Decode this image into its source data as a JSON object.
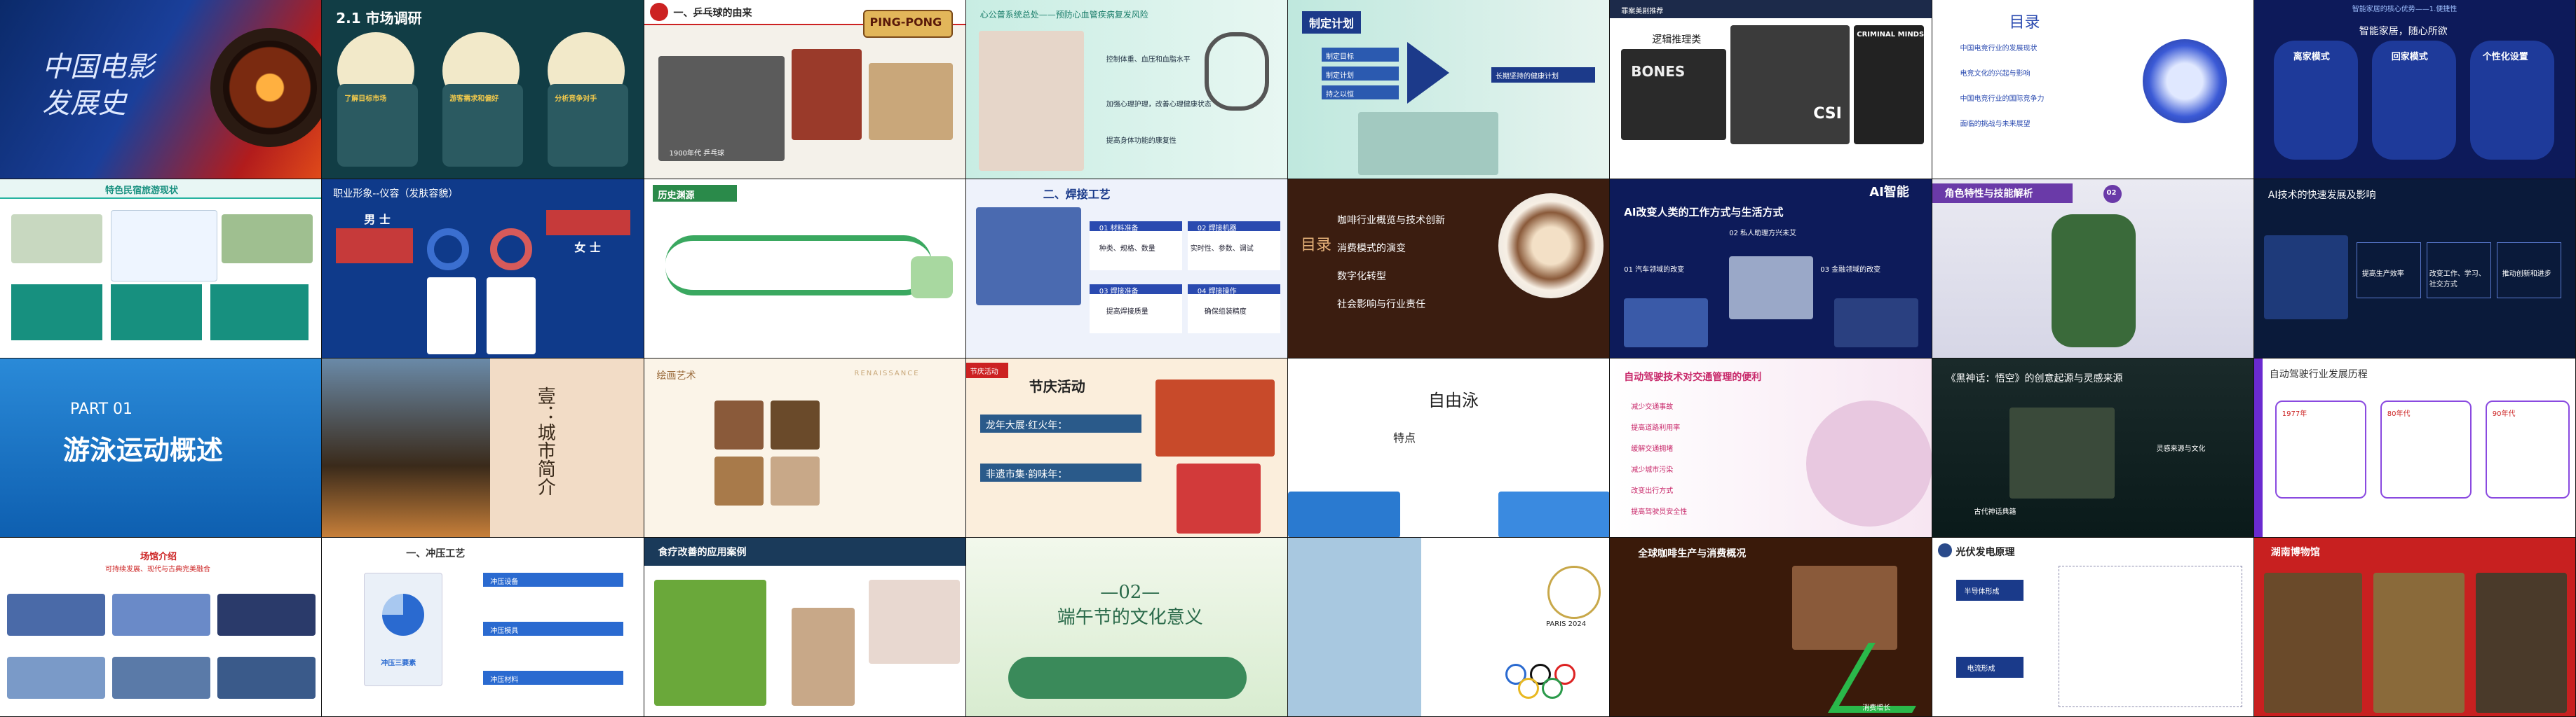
{
  "tiles": [
    {
      "title": "中国电影\n发展史"
    },
    {
      "title": "2.1  市场调研",
      "cards": [
        "了解目标市场",
        "游客需求和偏好",
        "分析竞争对手"
      ]
    },
    {
      "title": "一、乒乓球的由来",
      "sign": "PING-PONG",
      "caption": "1900年代  乒乓球"
    },
    {
      "title": "心公普系统总处——预防心血管疾病复发风险",
      "items": [
        "控制体重、血压和血脂水平",
        "加强心理护理，改善心理健康状态",
        "提高身体功能的康复性"
      ]
    },
    {
      "title": "制定计划",
      "items": [
        "制定目标",
        "制定计划",
        "持之以恒"
      ],
      "arrow": "长期坚持的健康计划"
    },
    {
      "title": "罪案美剧推荐",
      "subtitle": "逻辑推理类",
      "shows": [
        "BONES",
        "CRIMINAL MINDS",
        "CSI"
      ]
    },
    {
      "title": "目录",
      "items": [
        "中国电竞行业的发展现状",
        "电竞文化的兴起与影响",
        "中国电竞行业的国际竞争力",
        "面临的挑战与未来展望"
      ]
    },
    {
      "title": "智能家居的核心优势——1.便捷性",
      "subtitle": "智能家居，随心所欲",
      "modes": [
        "离家模式",
        "回家模式",
        "个性化设置"
      ]
    },
    {
      "title": "特色民宿旅游现状"
    },
    {
      "title": "职业形象--仪容（发肤容貌）",
      "male": "男  士",
      "female": "女  士"
    },
    {
      "title": "历史渊源"
    },
    {
      "title": "二、焊接工艺",
      "items": [
        "01 材料准备",
        "02 焊接机器",
        "03 焊接准备",
        "04 焊接操作"
      ],
      "steps": [
        "种类、规格、数量",
        "实时性、参数、调试",
        "提高焊接质量",
        "确保组装精度"
      ]
    },
    {
      "menu": "目录",
      "items": [
        "咖啡行业概览与技术创新",
        "消费模式的演变",
        "数字化转型",
        "社会影响与行业责任"
      ]
    },
    {
      "title": "AI改变人类的工作方式与生活方式",
      "logo": "AI智能",
      "items": [
        "01 汽车领域的改变",
        "02 私人助理方兴未艾",
        "03 金融领域的改变"
      ]
    },
    {
      "title": "角色特性与技能解析",
      "tag": "02"
    },
    {
      "title": "AI技术的快速发展及影响",
      "labels": [
        "提高生产效率",
        "改变工作、学习、社交方式",
        "推动创新和进步"
      ]
    },
    {
      "part": "PART 01",
      "title": "游泳运动概述"
    },
    {
      "title": "壹：城市简介"
    },
    {
      "title": "绘画艺术",
      "header": "RENAISSANCE"
    },
    {
      "title": "节庆活动",
      "tag": "节庆活动",
      "items": [
        "龙年大展·红火年：",
        "非遗市集·韵味年："
      ]
    },
    {
      "title": "自由泳",
      "sub": "特点"
    },
    {
      "title": "自动驾驶技术对交通管理的便利",
      "items": [
        "减少交通事故",
        "提高道路利用率",
        "缓解交通拥堵",
        "减少城市污染",
        "改变出行方式",
        "提高驾驶员安全性"
      ]
    },
    {
      "title": "《黑神话：悟空》的创意起源与灵感来源",
      "labels": [
        "古代神话典籍",
        "灵感来源与文化"
      ]
    },
    {
      "title": "自动驾驶行业发展历程",
      "items": [
        "1977年",
        "80年代",
        "90年代"
      ]
    },
    {
      "title": "场馆介绍",
      "subtitle": "可持续发展、现代与古典完美融合"
    },
    {
      "title": "一、冲压工艺",
      "items": [
        "冲压设备",
        "冲压模具",
        "冲压材料"
      ],
      "hub": "冲压三要素"
    },
    {
      "title": "食疗改善的应用案例"
    },
    {
      "title": "—02—\n端午节的文化意义"
    },
    {
      "logo": "PARIS 2024"
    },
    {
      "title": "全球咖啡生产与消费概况",
      "label": "消费增长"
    },
    {
      "title": "光伏发电原理",
      "items": [
        "半导体形成",
        "电流形成"
      ]
    },
    {
      "title": "湖南博物馆"
    }
  ]
}
